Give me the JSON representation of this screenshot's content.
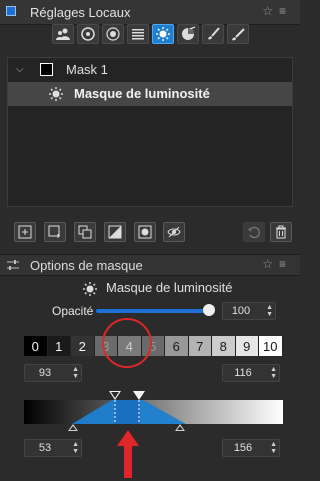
{
  "panel": {
    "title": "Réglages Locaux",
    "active_color": "#1e7fd0",
    "tools": [
      {
        "name": "people-icon",
        "active": false
      },
      {
        "name": "target-icon",
        "active": false
      },
      {
        "name": "eye-icon",
        "active": false
      },
      {
        "name": "lines-icon",
        "active": false
      },
      {
        "name": "luminosity-gear-icon",
        "active": true
      },
      {
        "name": "color-wheel-icon",
        "active": false
      },
      {
        "name": "brush-icon",
        "active": false
      },
      {
        "name": "brush-2-icon",
        "active": false
      }
    ]
  },
  "masks": {
    "parent_label": "Mask 1",
    "child_label": "Masque de luminosité"
  },
  "options": {
    "title": "Options de masque",
    "mask_type": "Masque de luminosité",
    "opacity_label": "Opacité",
    "opacity_value": "100",
    "opacity_fraction": 1.0,
    "zone_labels": [
      "0",
      "1",
      "2",
      "3",
      "4",
      "5",
      "6",
      "7",
      "8",
      "9",
      "10"
    ],
    "selected_zone": "4",
    "range_left": "93",
    "range_right": "116",
    "feather_left": "53",
    "feather_right": "156",
    "highlight_color": "#e0262a"
  }
}
